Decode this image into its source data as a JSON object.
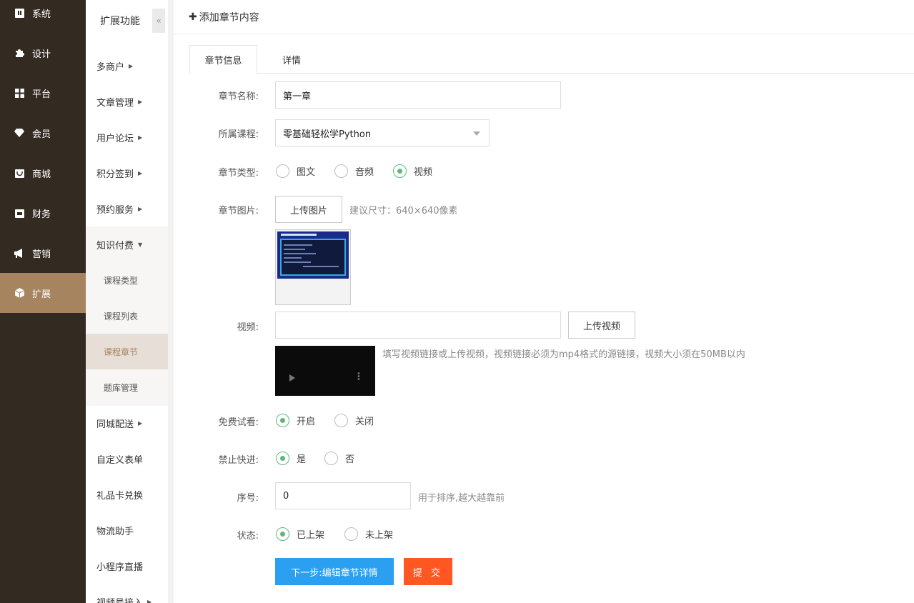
{
  "main_nav": [
    {
      "label": "系统",
      "icon": "system-icon"
    },
    {
      "label": "设计",
      "icon": "puzzle-icon"
    },
    {
      "label": "平台",
      "icon": "grid-icon"
    },
    {
      "label": "会员",
      "icon": "gem-icon"
    },
    {
      "label": "商城",
      "icon": "shop-icon"
    },
    {
      "label": "财务",
      "icon": "wallet-icon"
    },
    {
      "label": "营销",
      "icon": "megaphone-icon"
    },
    {
      "label": "扩展",
      "icon": "cube-icon",
      "active": true
    }
  ],
  "sub_nav": {
    "title": "扩展功能",
    "collapse_glyph": "«",
    "items": [
      {
        "label": "多商户",
        "has_arrow": true
      },
      {
        "label": "文章管理",
        "has_arrow": true
      },
      {
        "label": "用户论坛",
        "has_arrow": true
      },
      {
        "label": "积分签到",
        "has_arrow": true
      },
      {
        "label": "预约服务",
        "has_arrow": true
      },
      {
        "label": "知识付费",
        "expanded": true
      },
      {
        "label": "同城配送",
        "has_arrow": true
      },
      {
        "label": "自定义表单"
      },
      {
        "label": "礼品卡兑换"
      },
      {
        "label": "物流助手"
      },
      {
        "label": "小程序直播"
      },
      {
        "label": "视频号接入",
        "has_arrow": true
      }
    ],
    "children": [
      {
        "label": "课程类型"
      },
      {
        "label": "课程列表"
      },
      {
        "label": "课程章节",
        "active": true
      },
      {
        "label": "题库管理"
      }
    ]
  },
  "topbar": {
    "add_label": "添加章节内容",
    "plus": "✚"
  },
  "tabs": [
    {
      "label": "章节信息",
      "active": true
    },
    {
      "label": "详情"
    }
  ],
  "form": {
    "name_label": "章节名称:",
    "name_value": "第一章",
    "course_label": "所属课程:",
    "course_value": "零基础轻松学Python",
    "type_label": "章节类型:",
    "type_options": [
      {
        "label": "图文",
        "checked": false
      },
      {
        "label": "音频",
        "checked": false
      },
      {
        "label": "视频",
        "checked": true
      }
    ],
    "image_label": "章节图片:",
    "upload_image": "上传图片",
    "image_hint": "建议尺寸：640×640像素",
    "video_label": "视频:",
    "video_value": "",
    "upload_video": "上传视频",
    "video_hint": "填写视频链接或上传视频，视频链接必须为mp4格式的源链接，视频大小须在50MB以内",
    "trial_label": "免费试看:",
    "trial_options": [
      {
        "label": "开启",
        "checked": true
      },
      {
        "label": "关闭",
        "checked": false
      }
    ],
    "forward_label": "禁止快进:",
    "forward_options": [
      {
        "label": "是",
        "checked": true
      },
      {
        "label": "否",
        "checked": false
      }
    ],
    "sort_label": "序号:",
    "sort_value": "0",
    "sort_hint": "用于排序,越大越靠前",
    "status_label": "状态:",
    "status_options": [
      {
        "label": "已上架",
        "checked": true
      },
      {
        "label": "未上架",
        "checked": false
      }
    ],
    "next_button": "下一步:编辑章节详情",
    "submit_button": "提 交"
  },
  "colors": {
    "sidebar_bg": "#332a22",
    "active_accent": "#a6845f",
    "primary": "#2ba0f0",
    "submit": "#ff5722",
    "radio_on": "#5fb878"
  }
}
